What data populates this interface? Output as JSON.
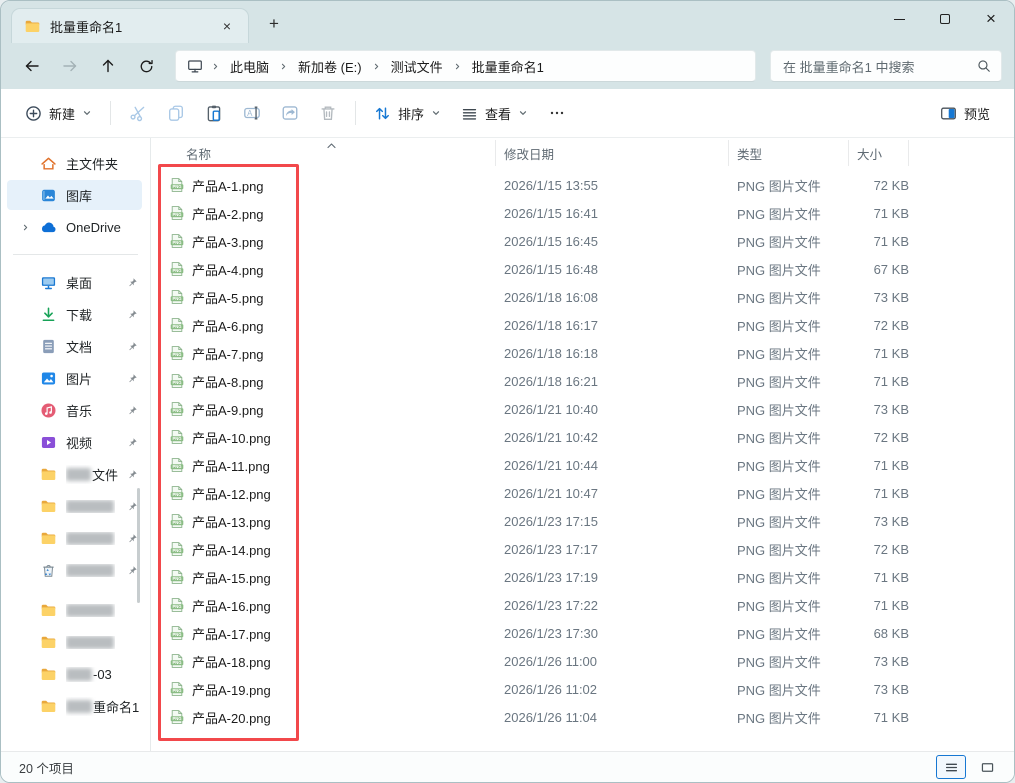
{
  "window": {
    "tab_title": "批量重命名1"
  },
  "address_bar": {
    "breadcrumb": [
      "此电脑",
      "新加卷 (E:)",
      "测试文件",
      "批量重命名1"
    ],
    "search_placeholder": "在 批量重命名1 中搜索"
  },
  "toolbar": {
    "new_label": "新建",
    "sort_label": "排序",
    "view_label": "查看",
    "preview_label": "预览"
  },
  "sidebar": {
    "top_items": [
      {
        "label": "主文件夹",
        "icon": "home-icon"
      },
      {
        "label": "图库",
        "icon": "gallery-icon",
        "selected": true
      },
      {
        "label": "OneDrive",
        "icon": "onedrive-icon",
        "expandable": true
      }
    ],
    "items": [
      {
        "label": "桌面",
        "icon": "desktop-icon",
        "pinned": true
      },
      {
        "label": "下载",
        "icon": "download-icon",
        "pinned": true
      },
      {
        "label": "文档",
        "icon": "documents-icon",
        "pinned": true
      },
      {
        "label": "图片",
        "icon": "pictures-icon",
        "pinned": true
      },
      {
        "label": "音乐",
        "icon": "music-icon",
        "pinned": true
      },
      {
        "label": "视频",
        "icon": "videos-icon",
        "pinned": true
      },
      {
        "label": "文件",
        "icon": "folder-icon",
        "pinned": true,
        "redacted": "partial"
      },
      {
        "label": "",
        "icon": "folder-icon",
        "pinned": true,
        "redacted": "full"
      },
      {
        "label": "",
        "icon": "folder-icon",
        "pinned": true,
        "redacted": "full"
      },
      {
        "label": "",
        "icon": "recycle-bin-icon",
        "pinned": true,
        "redacted": "full"
      },
      {
        "label": "",
        "icon": "folder-icon",
        "redacted": "full"
      },
      {
        "label": "",
        "icon": "folder-icon",
        "redacted": "full"
      },
      {
        "label": "-03",
        "icon": "folder-icon",
        "redacted": "partial"
      },
      {
        "label": "重命名1",
        "icon": "folder-icon",
        "redacted": "partial"
      }
    ]
  },
  "file_list": {
    "columns": [
      "名称",
      "修改日期",
      "类型",
      "大小"
    ],
    "sort": {
      "column": "名称",
      "ascending": true
    },
    "rows": [
      {
        "name": "产品A-1.png",
        "date": "2026/1/15 13:55",
        "type": "PNG 图片文件",
        "size": "72 KB"
      },
      {
        "name": "产品A-2.png",
        "date": "2026/1/15 16:41",
        "type": "PNG 图片文件",
        "size": "71 KB"
      },
      {
        "name": "产品A-3.png",
        "date": "2026/1/15 16:45",
        "type": "PNG 图片文件",
        "size": "71 KB"
      },
      {
        "name": "产品A-4.png",
        "date": "2026/1/15 16:48",
        "type": "PNG 图片文件",
        "size": "67 KB"
      },
      {
        "name": "产品A-5.png",
        "date": "2026/1/18 16:08",
        "type": "PNG 图片文件",
        "size": "73 KB"
      },
      {
        "name": "产品A-6.png",
        "date": "2026/1/18 16:17",
        "type": "PNG 图片文件",
        "size": "72 KB"
      },
      {
        "name": "产品A-7.png",
        "date": "2026/1/18 16:18",
        "type": "PNG 图片文件",
        "size": "71 KB"
      },
      {
        "name": "产品A-8.png",
        "date": "2026/1/18 16:21",
        "type": "PNG 图片文件",
        "size": "71 KB"
      },
      {
        "name": "产品A-9.png",
        "date": "2026/1/21 10:40",
        "type": "PNG 图片文件",
        "size": "73 KB"
      },
      {
        "name": "产品A-10.png",
        "date": "2026/1/21 10:42",
        "type": "PNG 图片文件",
        "size": "72 KB"
      },
      {
        "name": "产品A-11.png",
        "date": "2026/1/21 10:44",
        "type": "PNG 图片文件",
        "size": "71 KB"
      },
      {
        "name": "产品A-12.png",
        "date": "2026/1/21 10:47",
        "type": "PNG 图片文件",
        "size": "71 KB"
      },
      {
        "name": "产品A-13.png",
        "date": "2026/1/23 17:15",
        "type": "PNG 图片文件",
        "size": "73 KB"
      },
      {
        "name": "产品A-14.png",
        "date": "2026/1/23 17:17",
        "type": "PNG 图片文件",
        "size": "72 KB"
      },
      {
        "name": "产品A-15.png",
        "date": "2026/1/23 17:19",
        "type": "PNG 图片文件",
        "size": "71 KB"
      },
      {
        "name": "产品A-16.png",
        "date": "2026/1/23 17:22",
        "type": "PNG 图片文件",
        "size": "71 KB"
      },
      {
        "name": "产品A-17.png",
        "date": "2026/1/23 17:30",
        "type": "PNG 图片文件",
        "size": "68 KB"
      },
      {
        "name": "产品A-18.png",
        "date": "2026/1/26 11:00",
        "type": "PNG 图片文件",
        "size": "73 KB"
      },
      {
        "name": "产品A-19.png",
        "date": "2026/1/26 11:02",
        "type": "PNG 图片文件",
        "size": "73 KB"
      },
      {
        "name": "产品A-20.png",
        "date": "2026/1/26 11:04",
        "type": "PNG 图片文件",
        "size": "71 KB"
      }
    ]
  },
  "status_bar": {
    "count": "20 个项目"
  },
  "colors": {
    "accent": "#1677d2",
    "annotation": "#f2484b",
    "selection_bg": "#e6f1fa",
    "chrome": "#d6e4e6"
  }
}
